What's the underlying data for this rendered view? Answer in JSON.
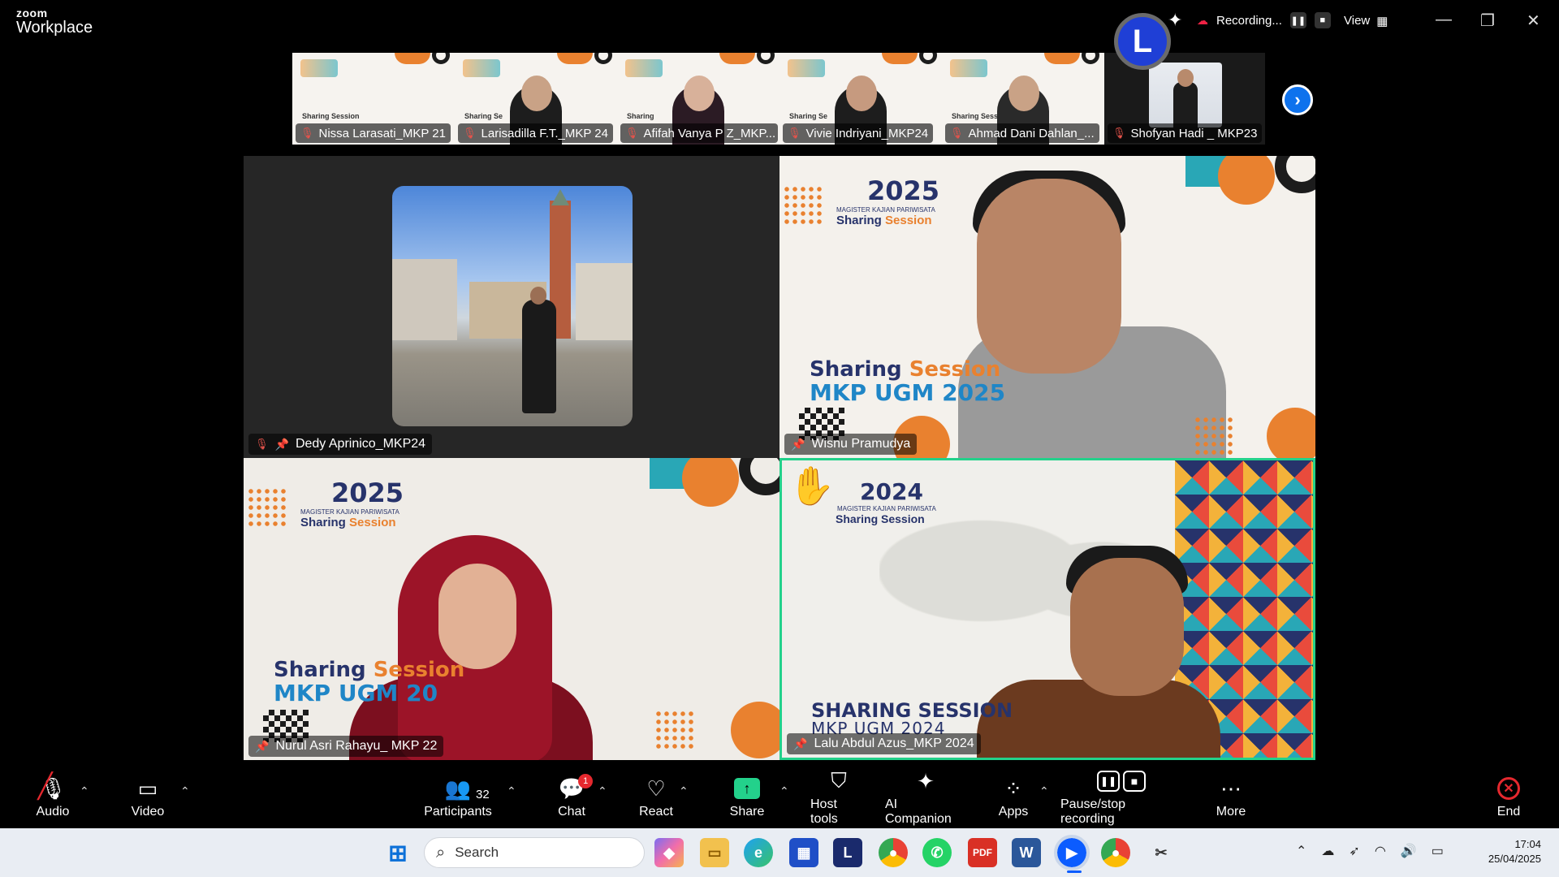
{
  "app": {
    "brand_top": "zoom",
    "brand_bottom": "Workplace",
    "host_initial": "L",
    "recording_label": "Recording...",
    "view_label": "View"
  },
  "thumbnails": [
    {
      "name": "Nissa Larasati_MKP 21",
      "bg_text": "Sharing Session"
    },
    {
      "name": "Larisadilla F.T._MKP 24",
      "bg_text": "Sharing Se"
    },
    {
      "name": "Afifah Vanya P Z_MKP...",
      "bg_text": "Sharing"
    },
    {
      "name": "Vivie Indriyani_MKP24",
      "bg_text": "Sharing Se"
    },
    {
      "name": "Ahmad Dani Dahlan_...",
      "bg_text": "Sharing Sess"
    },
    {
      "name": "Shofyan Hadi _ MKP23",
      "bg_text": ""
    }
  ],
  "tiles": [
    {
      "name": "Dedy Aprinico_MKP24"
    },
    {
      "name": "Wisnu Pramudya",
      "logo_year": "2025",
      "logo_sub": "MAGISTER KAJIAN PARIWISATA",
      "logo_session_a": "Sharing",
      "logo_session_b": "Session",
      "title_a1": "Sharing",
      "title_a2": "Session",
      "title_b": "MKP UGM 2025"
    },
    {
      "name": "Nurul Asri Rahayu_ MKP 22",
      "logo_year": "2025",
      "logo_sub": "MAGISTER KAJIAN PARIWISATA",
      "logo_session_a": "Sharing",
      "logo_session_b": "Session",
      "title_a1": "Sharing",
      "title_a2": "Session",
      "title_b": "MKP UGM 20"
    },
    {
      "name": "Lalu Abdul Azus_MKP 2024",
      "logo_year": "2024",
      "logo_sub": "MAGISTER KAJIAN PARIWISATA",
      "logo_session_a": "Sharing Session",
      "title_a": "SHARING SESSION",
      "title_b": "MKP UGM 2024"
    }
  ],
  "toolbar": {
    "audio": "Audio",
    "video": "Video",
    "participants": "Participants",
    "participants_count": "32",
    "chat": "Chat",
    "chat_badge": "1",
    "react": "React",
    "share": "Share",
    "host_tools": "Host tools",
    "ai_companion": "AI Companion",
    "apps": "Apps",
    "pause_stop": "Pause/stop recording",
    "more": "More",
    "end": "End"
  },
  "taskbar": {
    "search_placeholder": "Search",
    "time": "17:04",
    "date": "25/04/2025"
  },
  "colors": {
    "accent_green": "#23d18b",
    "brand_blue": "#0e72ed",
    "end_red": "#e5282e"
  }
}
